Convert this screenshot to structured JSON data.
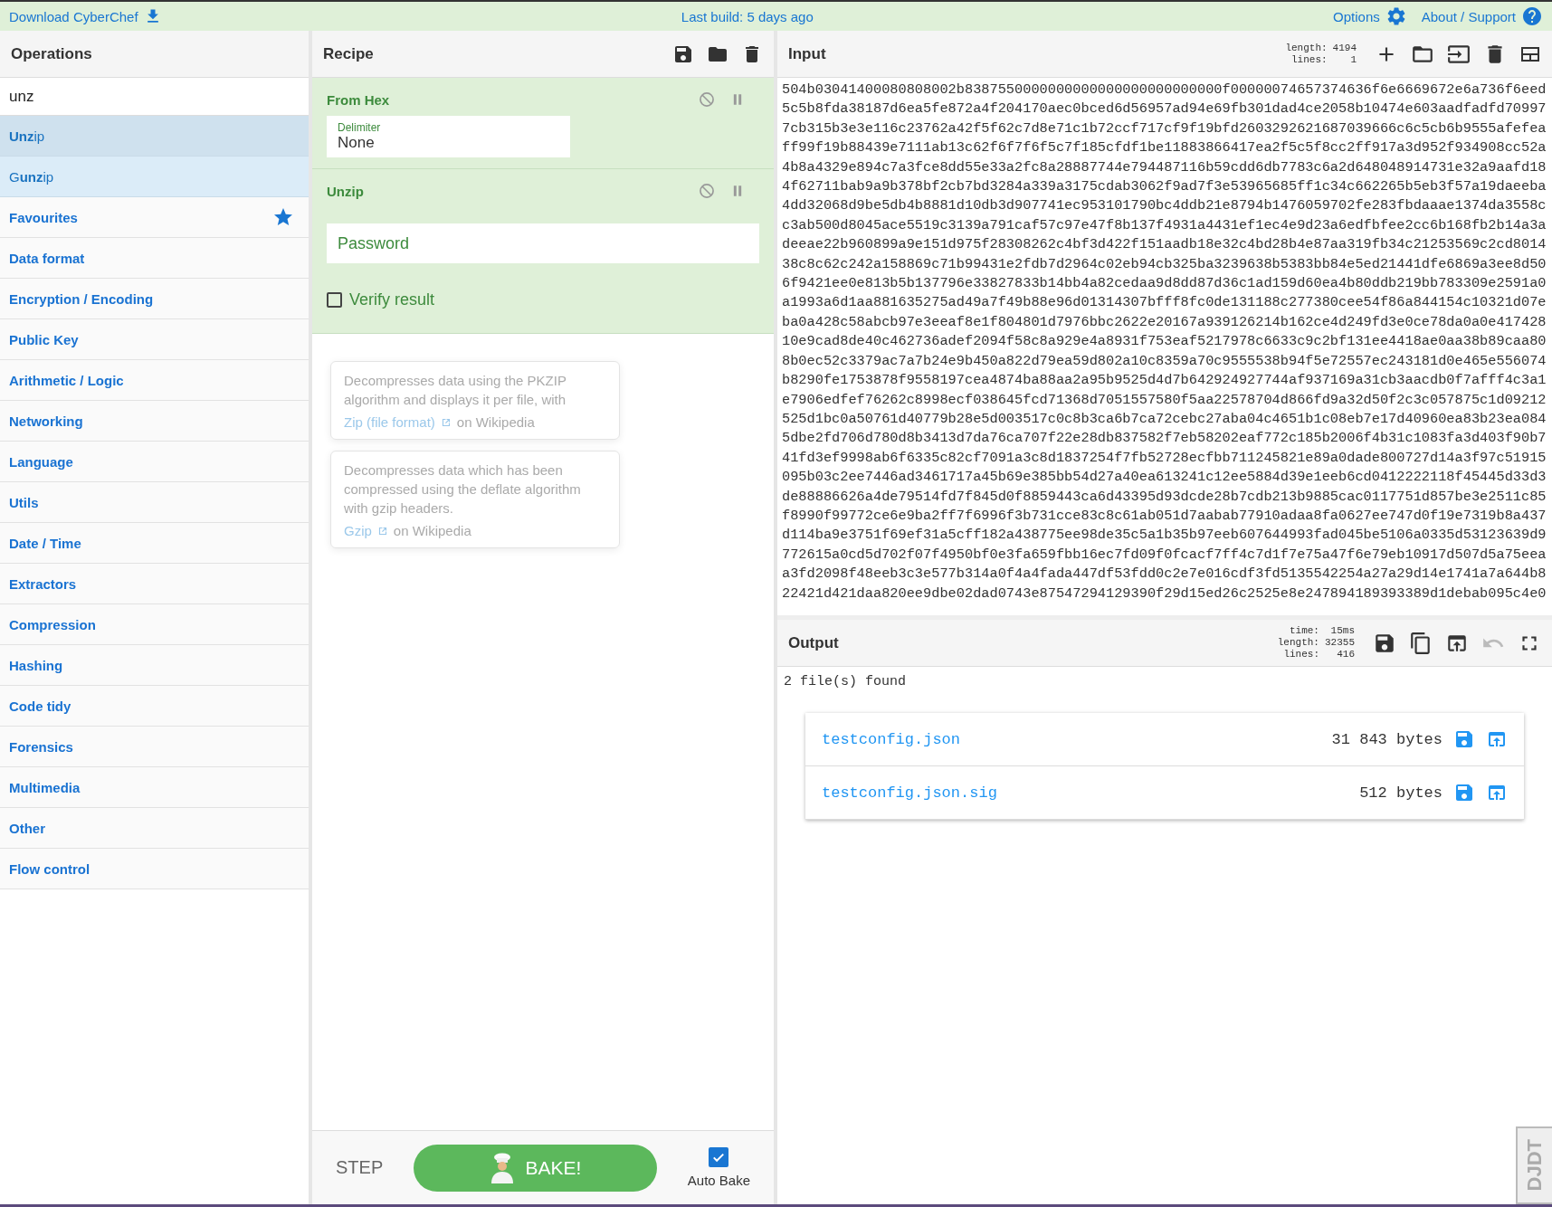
{
  "top_bar": {
    "download_link": "Download CyberChef",
    "build_info": "Last build: 5 days ago",
    "options_link": "Options",
    "support_link": "About / Support"
  },
  "operations": {
    "title": "Operations",
    "search": {
      "value": "unz"
    },
    "results": [
      {
        "label": "**Unz**ip",
        "selected": true
      },
      {
        "label": "G**unz**ip",
        "selected": false
      }
    ],
    "categories": [
      {
        "label": "Favourites",
        "kind": "favourites"
      },
      {
        "label": "Data format",
        "kind": "category"
      },
      {
        "label": "Encryption / Encoding",
        "kind": "category"
      },
      {
        "label": "Public Key",
        "kind": "category"
      },
      {
        "label": "Arithmetic / Logic",
        "kind": "category"
      },
      {
        "label": "Networking",
        "kind": "category"
      },
      {
        "label": "Language",
        "kind": "category"
      },
      {
        "label": "Utils",
        "kind": "category"
      },
      {
        "label": "Date / Time",
        "kind": "category"
      },
      {
        "label": "Extractors",
        "kind": "category"
      },
      {
        "label": "Compression",
        "kind": "category"
      },
      {
        "label": "Hashing",
        "kind": "category"
      },
      {
        "label": "Code tidy",
        "kind": "category"
      },
      {
        "label": "Forensics",
        "kind": "category"
      },
      {
        "label": "Multimedia",
        "kind": "category"
      },
      {
        "label": "Other",
        "kind": "category"
      },
      {
        "label": "Flow control",
        "kind": "category"
      }
    ]
  },
  "recipe": {
    "title": "Recipe",
    "steps": [
      {
        "name": "From Hex",
        "args": [
          {
            "kind": "select",
            "label": "Delimiter",
            "value": "None"
          }
        ]
      },
      {
        "name": "Unzip",
        "args": [
          {
            "kind": "text",
            "placeholder": "Password"
          },
          {
            "kind": "checkbox",
            "label": "Verify result",
            "checked": false
          }
        ]
      }
    ],
    "popovers": [
      {
        "description": "Decompresses data using the PKZIP algorithm and displays it per file, with",
        "link": "Zip (file format)",
        "link_suffix": "on Wikipedia"
      },
      {
        "description": "Decompresses data which has been compressed using the deflate algorithm with gzip headers.",
        "link": "Gzip",
        "link_suffix": "on Wikipedia"
      }
    ],
    "step_label": "STEP",
    "bake_label": "BAKE!",
    "auto_bake": {
      "label": "Auto Bake",
      "checked": true
    }
  },
  "input": {
    "title": "Input",
    "stats": [
      {
        "label": "length:",
        "value": "4194"
      },
      {
        "label": "lines:",
        "value": "1"
      }
    ],
    "text_lines": [
      "504b03041400080808002b8387550000000000000000000000000f00000074657374636f6e6669672e6a736f6eed",
      "5c5b8fda38187d6ea5fe872a4f204170aec0bced6d56957ad94e69fb301dad4ce2058b10474e603aadfadfd70997",
      "7cb315b3e3e116c23762a42f5f62c7d8e71c1b72ccf717cf9f19bfd2603292621687039666c6c5cb6b9555afefea",
      "ff99f19b88439e7111ab13c62f6f7f6f5c7f185cfdf1be11883866417ea2f5c5f8cc2ff917a3d952f934908cc52a",
      "4b8a4329e894c7a3fce8dd55e33a2fc8a28887744e794487116b59cdd6db7783c6a2d648048914731e32a9aafd18",
      "4f62711bab9a9b378bf2cb7bd3284a339a3175cdab3062f9ad7f3e53965685ff1c34c662265b5eb3f57a19daeeba",
      "4dd32068d9be5db4b8881d10db3d907741ec953101790bc4ddb21e8794b1476059702fe283fbdaaae1374da3558c",
      "c3ab500d8045ace5519c3139a791caf57c97e47f8b137f4931a4431ef1ec4e9d23a6edfbfee2cc6b168fb2b14a3a",
      "deeae22b960899a9e151d975f28308262c4bf3d422f151aadb18e32c4bd28b4e87aa319fb34c21253569c2cd8014",
      "38c8c62c242a158869c71b99431e2fdb7d2964c02eb94cb325ba3239638b5383bb84e5ed21441dfe6869a3ee8d50",
      "6f9421ee0e813b5b137796e33827833b14bb4a82cedaa9d8dd87d36c1ad159d60ea4b80ddb219bb783309e2591a0",
      "a1993a6d1aa881635275ad49a7f49b88e96d01314307bfff8fc0de131188c277380cee54f86a844154c10321d07e",
      "ba0a428c58abcb97e3eeaf8e1f804801d7976bbc2622e20167a939126214b162ce4d249fd3e0ce78da0a0e417428",
      "10e9cad8de40c462736adef2094f58c8a929e4a8931f753eaf5217978c6633c9c2bf131ee4418ae0aa38b89caa80",
      "8b0ec52c3379ac7a7b24e9b450a822d79ea59d802a10c8359a70c9555538b94f5e72557ec243181d0e465e556074",
      "b8290fe1753878f9558197cea4874ba88aa2a95b9525d4d7b642924927744af937169a31cb3aacdb0f7afff4c3a1",
      "e7906edfef76262c8998ecf038645fcd71368d7051557580f5aa22578704d866fd9a32d50f2c3c057875c1d09212",
      "525d1bc0a50761d40779b28e5d003517c0c8b3ca6b7ca72cebc27aba04c4651b1c08eb7e17d40960ea83b23ea084",
      "5dbe2fd706d780d8b3413d7da76ca707f22e28db837582f7eb58202eaf772c185b2006f4b31c1083fa3d403f90b7",
      "41fd3ef9998ab6f6335c82cf7091a3c8d1837254f7fb52728ecfbb711245821e89a0dade800727d14a3f97c51915",
      "095b03c2ee7446ad3461717a45b69e385bb54d27a40ea613241c12ee5884d39e1eeb6cd0412222118f45445d33d3",
      "de88886626a4de79514fd7f845d0f8859443ca6d43395d93dcde28b7cdb213b9885cac0117751d857be3e2511c85",
      "f8990f99772ce6e9ba2ff7f6996f3b731cce83c8c61ab051d7aabab77910adaa8fa0627ee747d0f19e7319b8a437",
      "d114ba9e3751f69ef31a5cff182a438775ee98de35c5a1b35b97eeb607644993fad045be5106a0335d53123639d9",
      "772615a0cd5d702f07f4950bf0e3fa659fbb16ec7fd09f0fcacf7ff4c7d1f7e75a47f6e79eb10917d507d5a75eea",
      "a3fd2098f48eeb3c3e577b314a0f4a4fada447df53fdd0c2e7e016cdf3fd5135542254a27a29d14e1741a7a644b8",
      "22421d421daa820ee9dbe02dad0743e87547294129390f29d15ed26c2525e8e247894189393389d1debab095c4e0"
    ]
  },
  "output": {
    "title": "Output",
    "stats": [
      {
        "label": "time:",
        "value": "15ms"
      },
      {
        "label": "length:",
        "value": "32355"
      },
      {
        "label": "lines:",
        "value": "416"
      }
    ],
    "undo_disabled": true,
    "summary": "2 file(s) found",
    "files": [
      {
        "name": "testconfig.json",
        "size": "31 843 bytes"
      },
      {
        "name": "testconfig.json.sig",
        "size": "512 bytes"
      }
    ]
  },
  "debug_handle": "DJDT"
}
